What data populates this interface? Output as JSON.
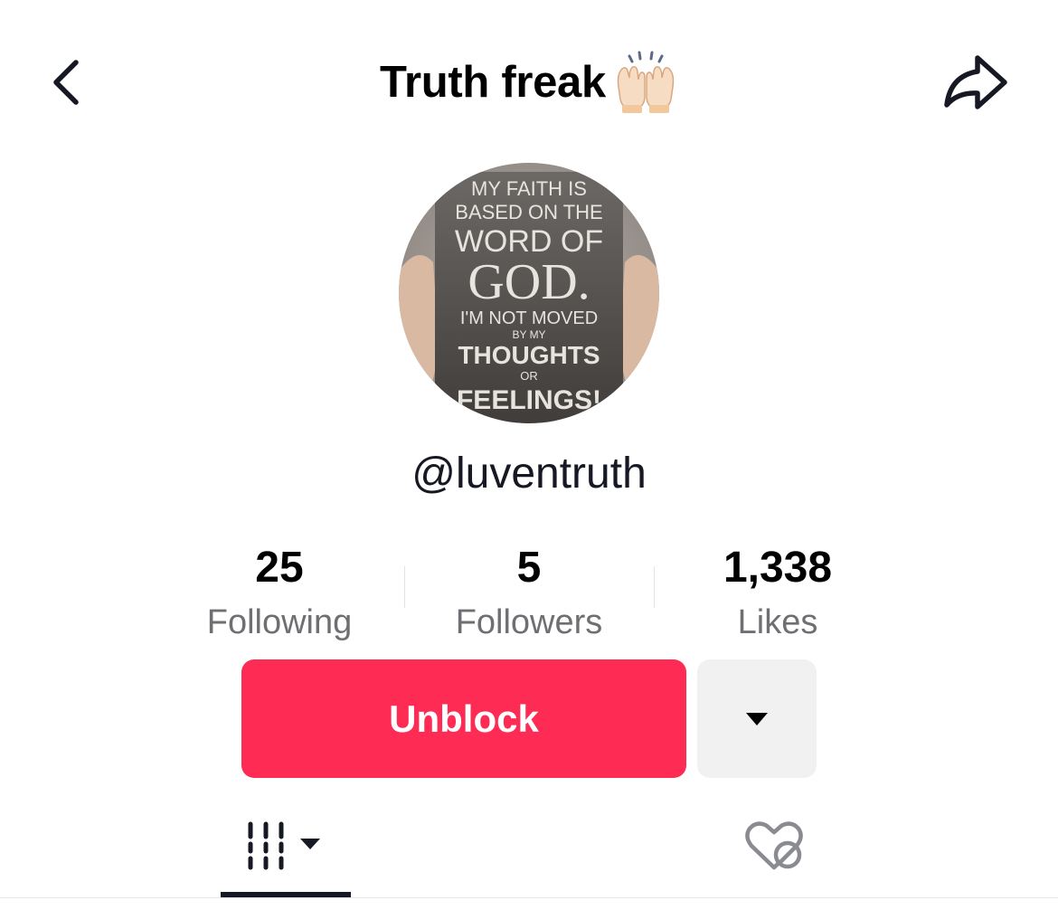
{
  "header": {
    "title": "Truth freak",
    "title_emoji_icon": "raising-hands-icon",
    "back_icon": "chevron-left-icon",
    "share_icon": "share-arrow-icon"
  },
  "profile": {
    "avatar_text": {
      "line1": "MY FAITH IS",
      "line2": "BASED ON THE",
      "line3": "WORD OF",
      "line4": "GOD.",
      "line5": "I'M NOT MOVED",
      "line6": "BY MY",
      "line7": "THOUGHTS",
      "line8": "OR",
      "line9": "FEELINGS!"
    },
    "username": "@luventruth"
  },
  "stats": {
    "following": {
      "value": "25",
      "label": "Following"
    },
    "followers": {
      "value": "5",
      "label": "Followers"
    },
    "likes": {
      "value": "1,338",
      "label": "Likes"
    }
  },
  "actions": {
    "primary_label": "Unblock",
    "more_icon": "caret-down-icon"
  },
  "tabs": {
    "videos_icon": "video-grid-icon",
    "liked_icon": "hidden-likes-heart-icon"
  },
  "colors": {
    "accent": "#fe2c55",
    "secondary_button": "#f1f1f2",
    "text_primary": "#161823",
    "text_secondary": "#6f6f73"
  }
}
